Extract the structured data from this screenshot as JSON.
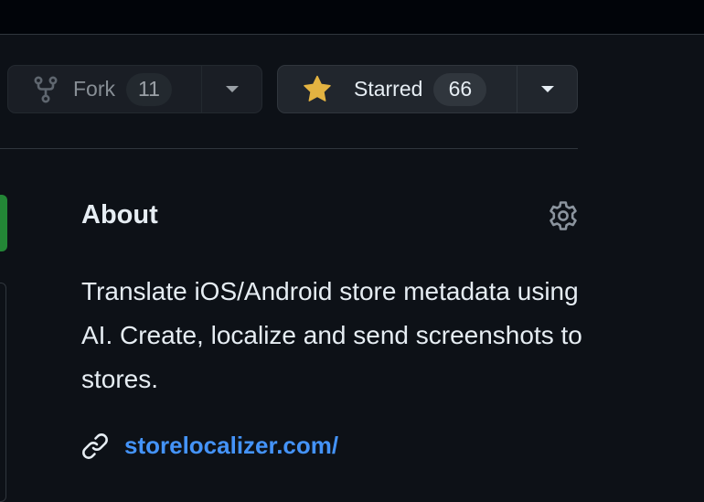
{
  "fork": {
    "label": "Fork",
    "count": "11"
  },
  "star": {
    "label": "Starred",
    "count": "66"
  },
  "about": {
    "title": "About",
    "description": "Translate iOS/Android store metadata using AI. Create, localize and send screenshots to stores.",
    "website": "storelocalizer.com/"
  },
  "colors": {
    "background": "#0d1117",
    "button_bg": "#21262d",
    "border": "#30363d",
    "star": "#e3b341",
    "link": "#4493f8",
    "green": "#238636"
  },
  "icons": [
    "repo-forked-icon",
    "star-fill-icon",
    "chevron-down-icon",
    "gear-icon",
    "link-icon"
  ]
}
